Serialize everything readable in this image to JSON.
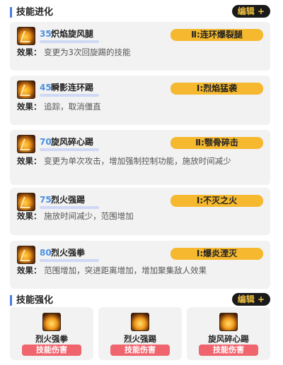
{
  "evolution": {
    "title": "技能进化",
    "edit_label": "编辑 +",
    "effect_label": "效果：",
    "skills": [
      {
        "level": "35",
        "name": "炽焰旋风腿",
        "evolution": "Ⅱ:连环爆裂腿",
        "effect": "变更为3次回旋踢的技能"
      },
      {
        "level": "45",
        "name": "瞬影连环踢",
        "evolution": "Ⅰ:烈焰猛袭",
        "effect": "追踪，取消僵直"
      },
      {
        "level": "70",
        "name": "旋风碎心踢",
        "evolution": "Ⅱ:颚骨碎击",
        "effect": "变更为单次攻击，增加强制控制功能，施放时间减少"
      },
      {
        "level": "75",
        "name": "烈火强踢",
        "evolution": "Ⅰ:不灭之火",
        "effect": "施放时间减少，范围增加"
      },
      {
        "level": "80",
        "name": "烈火强拳",
        "evolution": "Ⅰ:爆炎湮灭",
        "effect": "范围增加，突进距离增加，增加聚集敌人效果"
      }
    ]
  },
  "enhancement": {
    "title": "技能强化",
    "edit_label": "编辑 +",
    "items": [
      {
        "name": "烈火强拳",
        "tag": "技能伤害"
      },
      {
        "name": "烈火强踢",
        "tag": "技能伤害"
      },
      {
        "name": "旋风碎心踢",
        "tag": "技能伤害"
      }
    ]
  }
}
